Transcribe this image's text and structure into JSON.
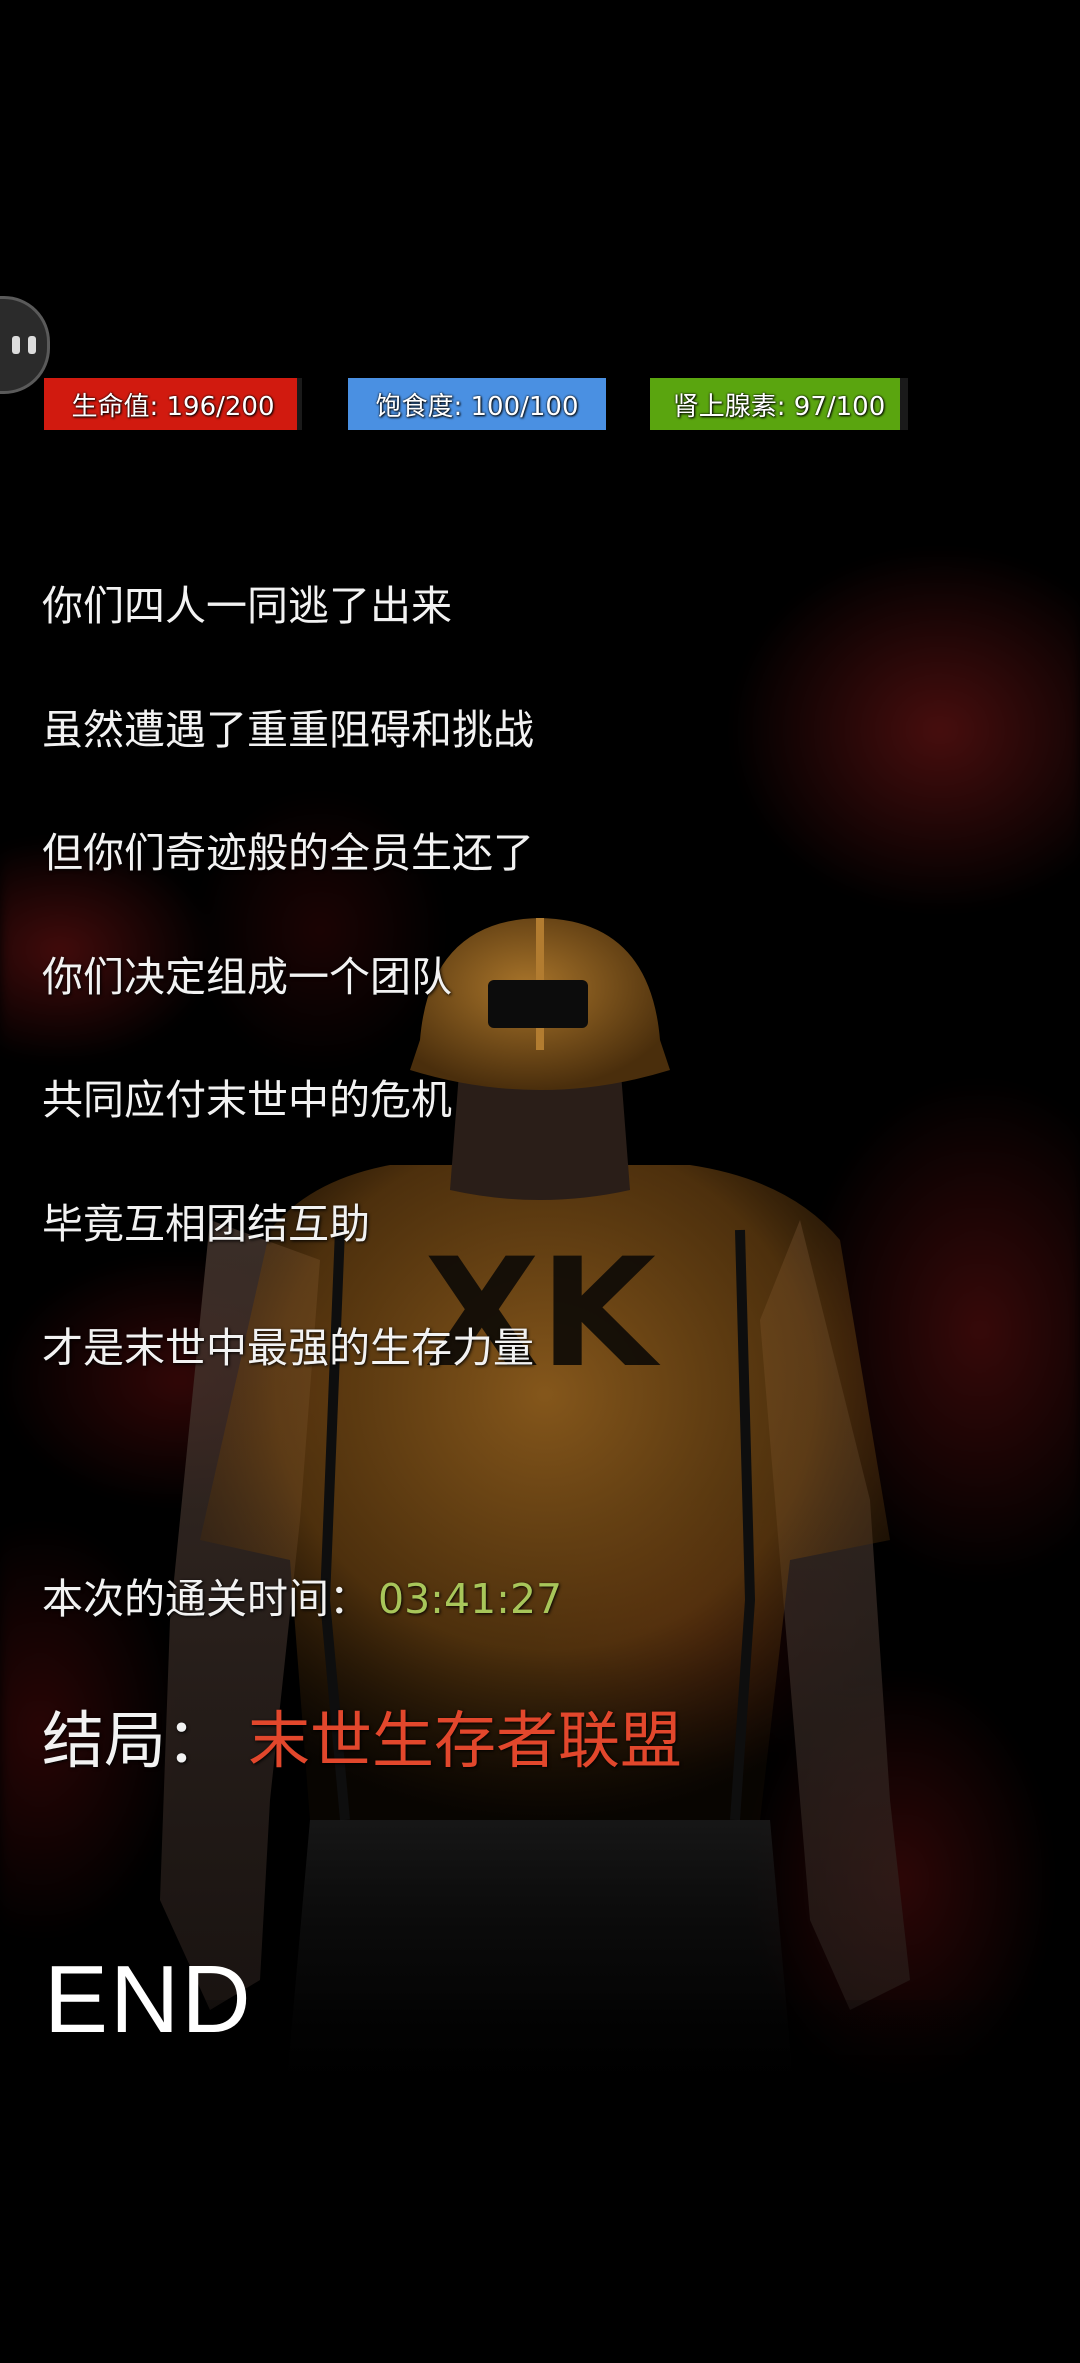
{
  "hud": {
    "menu_icon": "face-icon",
    "stats": [
      {
        "label": "生命值: 196/200",
        "value": 196,
        "max": 200,
        "color": "#d11a0f"
      },
      {
        "label": "饱食度: 100/100",
        "value": 100,
        "max": 100,
        "color": "#4a90e2"
      },
      {
        "label": "肾上腺素: 97/100",
        "value": 97,
        "max": 100,
        "color": "#5aa50f"
      }
    ]
  },
  "story": {
    "lines": [
      "你们四人一同逃了出来",
      "虽然遭遇了重重阻碍和挑战",
      "但你们奇迹般的全员生还了",
      "你们决定组成一个团队",
      "共同应付末世中的危机",
      "毕竟互相团结互助",
      "才是末世中最强的生存力量"
    ]
  },
  "result": {
    "time_label": "本次的通关时间：",
    "time_value": "03:41:27",
    "ending_label": "结局：",
    "ending_name": "末世生存者联盟",
    "end_text": "END"
  },
  "figure": {
    "shirt_logo": "XK",
    "colors": {
      "shirt": "#8a5a1a",
      "helmet": "#9a6a22"
    }
  }
}
